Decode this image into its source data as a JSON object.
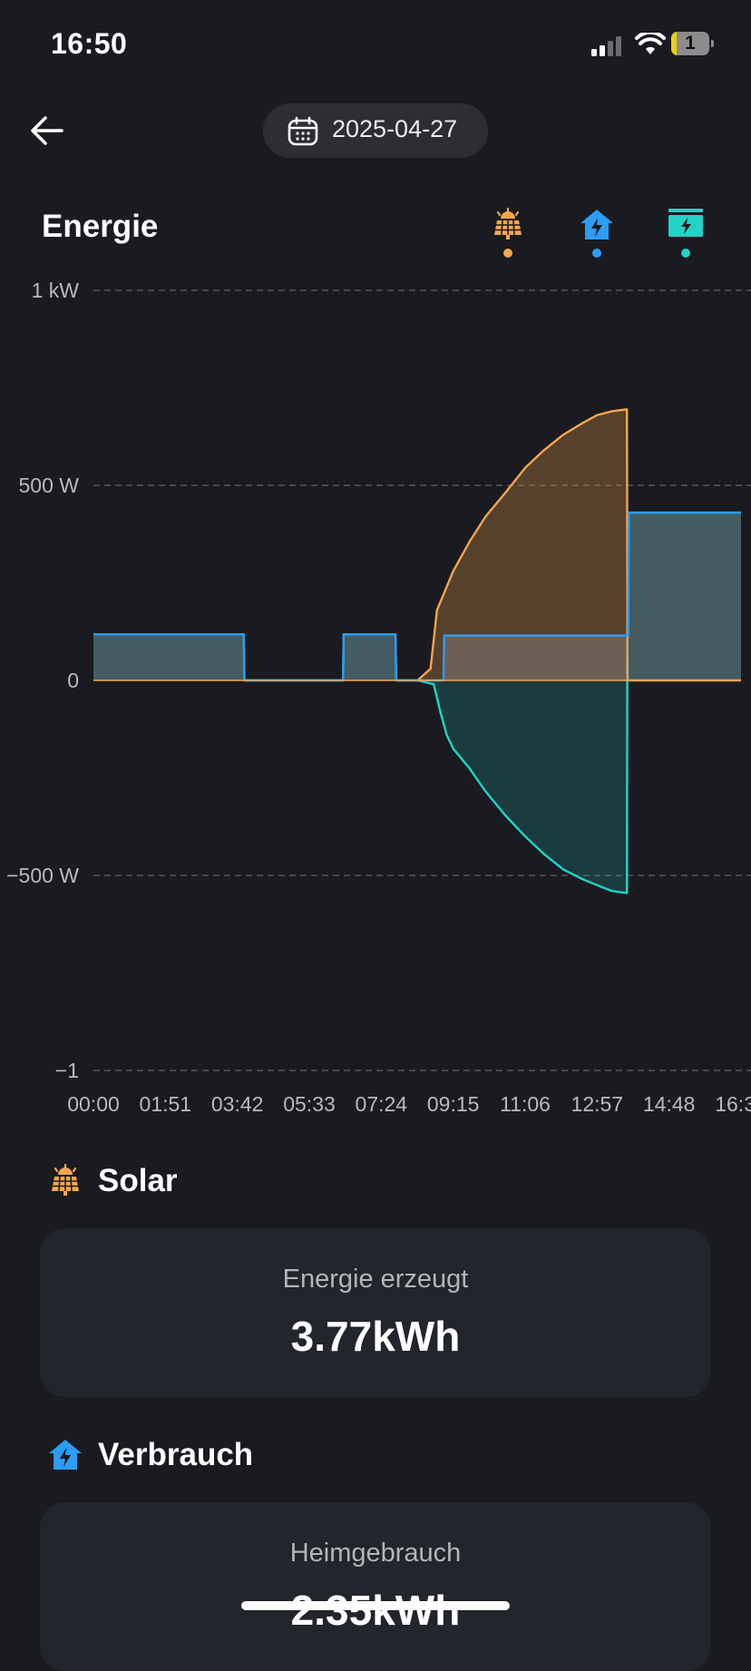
{
  "status_bar": {
    "time": "16:50",
    "battery_level": "1"
  },
  "header": {
    "date": "2025-04-27",
    "back_icon": "arrow-left-icon",
    "calendar_icon": "calendar-icon"
  },
  "energy": {
    "title": "Energie",
    "legend": [
      {
        "icon": "solar-panel-icon",
        "color": "#f5a64e"
      },
      {
        "icon": "home-lightning-icon",
        "color": "#2d9cf5"
      },
      {
        "icon": "battery-charger-icon",
        "color": "#22d3c5"
      }
    ]
  },
  "chart_data": {
    "type": "area",
    "y_tick_labels": [
      "1 kW",
      "500 W",
      "0",
      "−500 W",
      "−1"
    ],
    "y_ticks": [
      1000,
      500,
      0,
      -500,
      -1000
    ],
    "ylim": [
      -1000,
      1000
    ],
    "x_tick_labels": [
      "00:00",
      "01:51",
      "03:42",
      "05:33",
      "07:24",
      "09:15",
      "11:06",
      "12:57",
      "14:48",
      "16:39"
    ],
    "xlim_hours": [
      0,
      16.65
    ],
    "grid": true,
    "colors": {
      "solar": "#f5a64e",
      "home": "#2d9cf5",
      "battery": "#22d3c5"
    },
    "series": [
      {
        "key": "solar",
        "x": [
          "08:20",
          "08:40",
          "08:50",
          "09:15",
          "09:40",
          "10:05",
          "10:35",
          "11:06",
          "11:35",
          "12:05",
          "12:35",
          "12:57",
          "13:20",
          "13:43",
          "13:44",
          "16:39"
        ],
        "values": [
          0,
          30,
          180,
          280,
          355,
          420,
          480,
          545,
          590,
          630,
          660,
          680,
          690,
          695,
          0,
          0
        ]
      },
      {
        "key": "home",
        "x": [
          "00:00",
          "03:52",
          "03:53",
          "06:25",
          "06:26",
          "07:46",
          "07:47",
          "09:00",
          "09:01",
          "13:45",
          "13:46",
          "16:39"
        ],
        "values": [
          118,
          118,
          0,
          0,
          118,
          118,
          0,
          0,
          115,
          115,
          430,
          430
        ]
      },
      {
        "key": "battery",
        "x": [
          "00:00",
          "03:52",
          "03:53",
          "06:25",
          "06:26",
          "07:46",
          "07:47",
          "08:20",
          "08:45",
          "08:55",
          "09:05",
          "09:15",
          "09:40",
          "10:05",
          "10:35",
          "11:06",
          "11:35",
          "12:05",
          "12:35",
          "12:57",
          "13:20",
          "13:43",
          "13:44",
          "16:39"
        ],
        "values": [
          118,
          118,
          0,
          0,
          118,
          118,
          0,
          0,
          -10,
          -80,
          -140,
          -175,
          -225,
          -285,
          -345,
          -400,
          -445,
          -485,
          -510,
          -525,
          -540,
          -545,
          430,
          430
        ]
      }
    ]
  },
  "solar": {
    "title": "Solar",
    "card_label": "Energie erzeugt",
    "card_value": "3.77kWh"
  },
  "consumption": {
    "title": "Verbrauch",
    "card_label": "Heimgebrauch",
    "card_value": "2.35kWh"
  }
}
